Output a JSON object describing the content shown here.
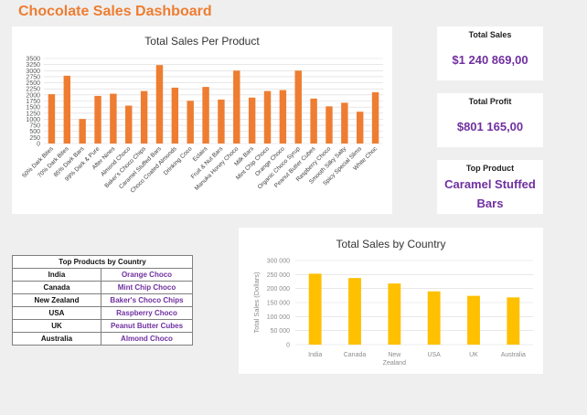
{
  "dashboard_title": "Chocolate Sales Dashboard",
  "colors": {
    "title": "#ee7d31",
    "bar_product": "#ee7d31",
    "bar_country": "#ffc000",
    "kpi": "#7030a0"
  },
  "kpis": {
    "total_sales_label": "Total Sales",
    "total_sales_value": "$1 240 869,00",
    "total_profit_label": "Total Profit",
    "total_profit_value": "$801 165,00",
    "top_product_label": "Top Product",
    "top_product_value_line1": "Caramel Stuffed",
    "top_product_value_line2": "Bars"
  },
  "top_products_table": {
    "header": "Top Products by Country",
    "rows": [
      {
        "country": "India",
        "product": "Orange Choco"
      },
      {
        "country": "Canada",
        "product": "Mint Chip Choco"
      },
      {
        "country": "New Zealand",
        "product": "Baker's Choco Chips"
      },
      {
        "country": "USA",
        "product": "Raspberry Choco"
      },
      {
        "country": "UK",
        "product": "Peanut Butter Cubes"
      },
      {
        "country": "Australia",
        "product": "Almond Choco"
      }
    ]
  },
  "chart_data": [
    {
      "type": "bar",
      "title": "Total Sales Per Product",
      "categories": [
        "50% Dark Bites",
        "70% Dark Bites",
        "85% Dark Bars",
        "99% Dark & Pure",
        "After Nines",
        "Almond Choco",
        "Baker's Choco Chips",
        "Caramel Stuffed Bars",
        "Choco Coated Almonds",
        "Drinking Coco",
        "Eclairs",
        "Fruit & Nut Bars",
        "Manuka Honey Choco",
        "Milk Bars",
        "Mint Chip Choco",
        "Orange Choco",
        "Organic Choco Syrup",
        "Peanut Butter Cubes",
        "Raspberry Choco",
        "Smooth Silky Salty",
        "Spicy Special Slims",
        "White Choc"
      ],
      "values": [
        2030,
        2790,
        1010,
        1960,
        2050,
        1560,
        2160,
        3230,
        2300,
        1760,
        2330,
        1810,
        3000,
        1890,
        2160,
        2200,
        3000,
        1850,
        1530,
        1680,
        1310,
        2110
      ],
      "yticks": [
        "0",
        "250",
        "500",
        "750",
        "1000",
        "1250",
        "1500",
        "1750",
        "2000",
        "2250",
        "2500",
        "2750",
        "3000",
        "3250",
        "3500"
      ],
      "ylim": [
        0,
        3500
      ],
      "grid": true
    },
    {
      "type": "bar",
      "title": "Total Sales by Country",
      "ylabel": "Total Sales (Dollars)",
      "categories": [
        "India",
        "Canada",
        "New Zealand",
        "USA",
        "UK",
        "Australia"
      ],
      "category_lines": [
        [
          "India"
        ],
        [
          "Canada"
        ],
        [
          "New",
          "Zealand"
        ],
        [
          "USA"
        ],
        [
          "UK"
        ],
        [
          "Australia"
        ]
      ],
      "values": [
        253000,
        237500,
        218000,
        190000,
        174000,
        168500
      ],
      "yticks": [
        "0",
        "50 000",
        "100 000",
        "150 000",
        "200 000",
        "250 000",
        "300 000"
      ],
      "ylim": [
        0,
        300000
      ],
      "grid": true
    }
  ]
}
